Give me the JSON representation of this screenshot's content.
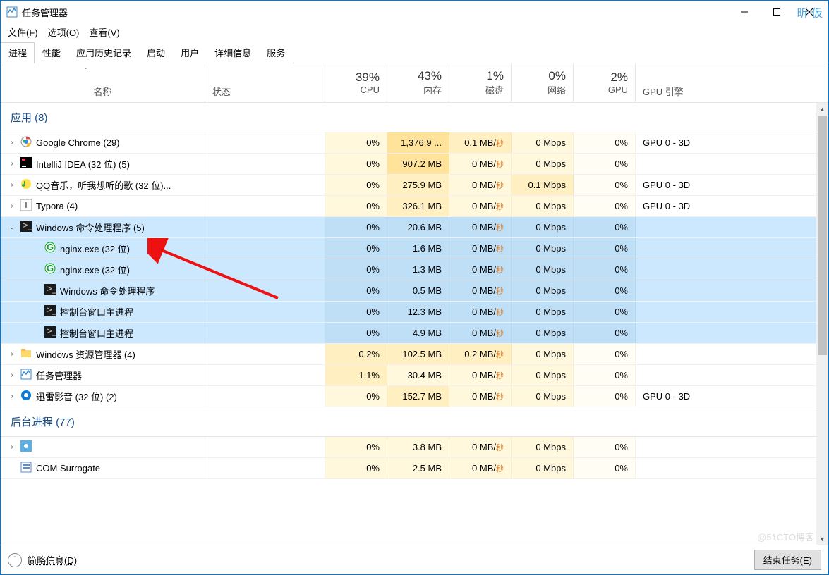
{
  "window": {
    "title": "任务管理器"
  },
  "watermark": "昕 仮",
  "watermark2": "@51CTO博客",
  "menu": {
    "file": "文件(F)",
    "options": "选项(O)",
    "view": "查看(V)"
  },
  "tabs": [
    {
      "label": "进程",
      "active": true
    },
    {
      "label": "性能"
    },
    {
      "label": "应用历史记录"
    },
    {
      "label": "启动"
    },
    {
      "label": "用户"
    },
    {
      "label": "详细信息"
    },
    {
      "label": "服务"
    }
  ],
  "columns": {
    "name": "名称",
    "state": "状态",
    "cpu": {
      "pct": "39%",
      "label": "CPU"
    },
    "mem": {
      "pct": "43%",
      "label": "内存"
    },
    "disk": {
      "pct": "1%",
      "label": "磁盘"
    },
    "net": {
      "pct": "0%",
      "label": "网络"
    },
    "gpu": {
      "pct": "2%",
      "label": "GPU"
    },
    "gpuengine": "GPU 引擎"
  },
  "sections": {
    "apps": "应用 (8)",
    "background": "后台进程 (77)"
  },
  "rows": [
    {
      "name": "Google Chrome (29)",
      "icon": "chrome",
      "exp": ">",
      "cpu": "0%",
      "mem": "1,376.9 ...",
      "disk": "0.1 MB/秒",
      "net": "0 Mbps",
      "gpu": "0%",
      "gpue": "GPU 0 - 3D",
      "cpuH": 1,
      "memH": 3,
      "diskH": 2,
      "netH": 1,
      "gpuH": 0
    },
    {
      "name": "IntelliJ IDEA (32 位) (5)",
      "icon": "intellij",
      "exp": ">",
      "cpu": "0%",
      "mem": "907.2 MB",
      "disk": "0 MB/秒",
      "net": "0 Mbps",
      "gpu": "0%",
      "gpue": "",
      "cpuH": 1,
      "memH": 3,
      "diskH": 1,
      "netH": 1,
      "gpuH": 0
    },
    {
      "name": "QQ音乐，听我想听的歌 (32 位)...",
      "icon": "qqmusic",
      "exp": ">",
      "cpu": "0%",
      "mem": "275.9 MB",
      "disk": "0 MB/秒",
      "net": "0.1 Mbps",
      "gpu": "0%",
      "gpue": "GPU 0 - 3D",
      "cpuH": 1,
      "memH": 2,
      "diskH": 1,
      "netH": 2,
      "gpuH": 0
    },
    {
      "name": "Typora (4)",
      "icon": "typora",
      "exp": ">",
      "cpu": "0%",
      "mem": "326.1 MB",
      "disk": "0 MB/秒",
      "net": "0 Mbps",
      "gpu": "0%",
      "gpue": "GPU 0 - 3D",
      "cpuH": 1,
      "memH": 2,
      "diskH": 1,
      "netH": 1,
      "gpuH": 0
    },
    {
      "name": "Windows 命令处理程序 (5)",
      "icon": "cmd",
      "exp": "v",
      "selected": true,
      "cpu": "0%",
      "mem": "20.6 MB",
      "disk": "0 MB/秒",
      "net": "0 Mbps",
      "gpu": "0%",
      "gpue": "",
      "cpuH": 1,
      "memH": 1,
      "diskH": 1,
      "netH": 1,
      "gpuH": 0
    },
    {
      "name": "nginx.exe (32 位)",
      "icon": "nginx",
      "child": true,
      "selected": true,
      "cpu": "0%",
      "mem": "1.6 MB",
      "disk": "0 MB/秒",
      "net": "0 Mbps",
      "gpu": "0%",
      "gpue": "",
      "cpuH": 1,
      "memH": 1,
      "diskH": 1,
      "netH": 1,
      "gpuH": 0
    },
    {
      "name": "nginx.exe (32 位)",
      "icon": "nginx",
      "child": true,
      "selected": true,
      "cpu": "0%",
      "mem": "1.3 MB",
      "disk": "0 MB/秒",
      "net": "0 Mbps",
      "gpu": "0%",
      "gpue": "",
      "cpuH": 1,
      "memH": 1,
      "diskH": 1,
      "netH": 1,
      "gpuH": 0
    },
    {
      "name": "Windows 命令处理程序",
      "icon": "cmd",
      "child": true,
      "selected": true,
      "cpu": "0%",
      "mem": "0.5 MB",
      "disk": "0 MB/秒",
      "net": "0 Mbps",
      "gpu": "0%",
      "gpue": "",
      "cpuH": 1,
      "memH": 1,
      "diskH": 1,
      "netH": 1,
      "gpuH": 0
    },
    {
      "name": "控制台窗口主进程",
      "icon": "cmd",
      "child": true,
      "selected": true,
      "cpu": "0%",
      "mem": "12.3 MB",
      "disk": "0 MB/秒",
      "net": "0 Mbps",
      "gpu": "0%",
      "gpue": "",
      "cpuH": 1,
      "memH": 1,
      "diskH": 1,
      "netH": 1,
      "gpuH": 0
    },
    {
      "name": "控制台窗口主进程",
      "icon": "cmd",
      "child": true,
      "selected": true,
      "cpu": "0%",
      "mem": "4.9 MB",
      "disk": "0 MB/秒",
      "net": "0 Mbps",
      "gpu": "0%",
      "gpue": "",
      "cpuH": 1,
      "memH": 1,
      "diskH": 1,
      "netH": 1,
      "gpuH": 0
    },
    {
      "name": "Windows 资源管理器 (4)",
      "icon": "explorer",
      "exp": ">",
      "cpu": "0.2%",
      "mem": "102.5 MB",
      "disk": "0.2 MB/秒",
      "net": "0 Mbps",
      "gpu": "0%",
      "gpue": "",
      "cpuH": 2,
      "memH": 2,
      "diskH": 2,
      "netH": 1,
      "gpuH": 0
    },
    {
      "name": "任务管理器",
      "icon": "taskmgr",
      "exp": ">",
      "cpu": "1.1%",
      "mem": "30.4 MB",
      "disk": "0 MB/秒",
      "net": "0 Mbps",
      "gpu": "0%",
      "gpue": "",
      "cpuH": 2,
      "memH": 1,
      "diskH": 1,
      "netH": 1,
      "gpuH": 0
    },
    {
      "name": "迅雷影音 (32 位) (2)",
      "icon": "xunlei",
      "exp": ">",
      "cpu": "0%",
      "mem": "152.7 MB",
      "disk": "0 MB/秒",
      "net": "0 Mbps",
      "gpu": "0%",
      "gpue": "GPU 0 - 3D",
      "cpuH": 1,
      "memH": 2,
      "diskH": 1,
      "netH": 1,
      "gpuH": 0
    }
  ],
  "bgrows": [
    {
      "name": "",
      "icon": "gear",
      "exp": ">",
      "cpu": "0%",
      "mem": "3.8 MB",
      "disk": "0 MB/秒",
      "net": "0 Mbps",
      "gpu": "0%",
      "gpue": "",
      "cpuH": 1,
      "memH": 1,
      "diskH": 1,
      "netH": 1,
      "gpuH": 0
    },
    {
      "name": "COM Surrogate",
      "icon": "com",
      "cpu": "0%",
      "mem": "2.5 MB",
      "disk": "0 MB/秒",
      "net": "0 Mbps",
      "gpu": "0%",
      "gpue": "",
      "cpuH": 1,
      "memH": 1,
      "diskH": 1,
      "netH": 1,
      "gpuH": 0
    }
  ],
  "footer": {
    "fewer": "简略信息(D)",
    "end": "结束任务(E)"
  }
}
